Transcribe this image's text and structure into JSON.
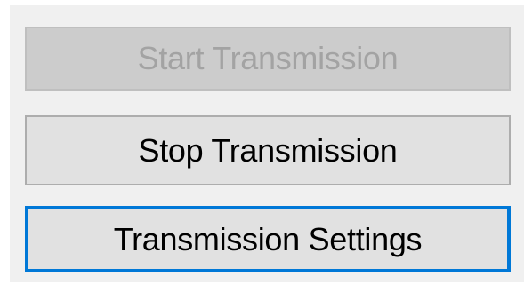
{
  "buttons": {
    "start": {
      "label": "Start Transmission",
      "state": "disabled"
    },
    "stop": {
      "label": "Stop Transmission",
      "state": "normal"
    },
    "settings": {
      "label": "Transmission Settings",
      "state": "focused"
    }
  },
  "colors": {
    "panel_background": "#f0f0f0",
    "button_face": "#e1e1e1",
    "disabled_face": "#cccccc",
    "disabled_text": "#a3a3a3",
    "focus_border": "#0078d7"
  }
}
